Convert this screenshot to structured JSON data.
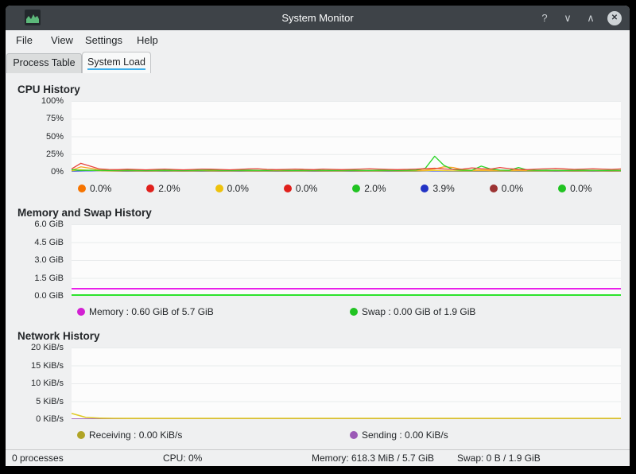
{
  "titlebar": {
    "title": "System Monitor",
    "help_glyph": "?",
    "minimize_glyph": "∨",
    "maximize_glyph": "∧",
    "close_glyph": "✕"
  },
  "menubar": {
    "items": [
      "File",
      "View",
      "Settings",
      "Help"
    ]
  },
  "tabs": {
    "process_table": "Process Table",
    "system_load": "System Load"
  },
  "accent_color": "#3daee9",
  "chart_data": [
    {
      "id": "cpu",
      "type": "line",
      "title": "CPU History",
      "ylabel_ticks": [
        "100%",
        "75%",
        "50%",
        "25%",
        "0%"
      ],
      "ylim": [
        0,
        100
      ],
      "grid": true,
      "legend_position": "bottom",
      "series": [
        {
          "name": "cpu-blue",
          "color": "#3a52d4",
          "width": 1.2,
          "values": [
            0.8,
            1.4,
            0.9,
            0.6,
            0.6,
            0.7,
            0.6,
            0.6,
            0.7,
            0.6,
            0.6,
            0.7,
            0.6,
            0.6,
            0.7,
            0.6,
            0.6,
            0.7,
            0.6,
            1.2,
            0.8,
            0.6,
            0.7,
            0.6,
            0.6,
            0.7,
            0.6,
            0.6,
            0.7,
            0.6
          ]
        },
        {
          "name": "cpu-yellow",
          "color": "#ecd12b",
          "width": 1.3,
          "values": [
            1.5,
            3,
            2,
            1.4,
            1.2,
            1.2,
            1.3,
            1.2,
            1.1,
            1.2,
            1.3,
            1.2,
            1.1,
            1.2,
            1.3,
            1.2,
            1.1,
            1.2,
            1.3,
            1.2,
            1.1,
            1.2,
            1.3,
            1.2,
            1.1,
            1.2,
            1.3,
            1.2,
            1.1,
            1.2,
            1.3,
            1.2,
            1.1,
            1.2,
            1.3,
            1.2,
            1.1,
            1.2,
            1.4,
            2,
            1.6,
            1.3,
            1.2,
            1.2,
            1.4,
            1.2,
            1.1,
            1.2,
            1.3,
            1.2,
            1.1,
            1.2,
            1.3,
            1.2,
            1.1,
            1.2,
            1.3,
            1.2,
            1.1,
            1.2
          ]
        },
        {
          "name": "cpu-orange",
          "color": "#f7a325",
          "width": 1.3,
          "values": [
            2,
            7,
            5,
            2.5,
            1.8,
            1.6,
            1.8,
            2,
            1.6,
            1.8,
            2,
            1.8,
            1.6,
            1.8,
            2,
            1.8,
            1.6,
            1.8,
            2,
            1.8,
            1.6,
            2,
            1.8,
            1.6,
            1.8,
            2,
            1.8,
            1.6,
            1.8,
            2,
            1.8,
            1.6,
            1.8,
            2,
            1.8,
            1.6,
            1.8,
            2,
            2.4,
            4,
            7,
            6,
            3,
            2.2,
            2.6,
            2.2,
            1.8,
            2,
            2.4,
            2,
            1.8,
            2,
            2.2,
            1.8,
            1.6,
            1.8,
            2,
            1.8,
            1.6,
            1.8
          ]
        },
        {
          "name": "cpu-green",
          "color": "#2ad425",
          "width": 1.3,
          "values": [
            3,
            2,
            2.2,
            2,
            1.8,
            2,
            2.2,
            2,
            1.8,
            2,
            2.2,
            2,
            1.8,
            2,
            2.2,
            2.4,
            2,
            1.8,
            2,
            2.2,
            2,
            1.8,
            2.4,
            2,
            1.8,
            2,
            2.2,
            2,
            1.8,
            2,
            2.2,
            2,
            1.8,
            2.2,
            2,
            1.8,
            2,
            2.4,
            5,
            22,
            9,
            3,
            2.2,
            2,
            8,
            4,
            2.4,
            2,
            6,
            2.4,
            2,
            2.2,
            2,
            1.8,
            2,
            2.2,
            2,
            1.8,
            2,
            2
          ]
        },
        {
          "name": "cpu-red",
          "color": "#e8443e",
          "width": 1.3,
          "values": [
            4,
            12,
            8,
            4,
            3.2,
            3,
            3.6,
            3.2,
            2.8,
            3.4,
            3.8,
            3.2,
            2.8,
            3.2,
            3.8,
            3.6,
            3.2,
            2.8,
            3.4,
            4,
            4.2,
            3.4,
            3,
            3.4,
            3.8,
            3.4,
            3,
            3.8,
            3.4,
            3,
            3.4,
            3.8,
            4.2,
            3.8,
            3.4,
            3,
            3.4,
            3.8,
            4.4,
            5,
            4,
            3.4,
            3.8,
            5.5,
            4.5,
            3.8,
            6,
            4.5,
            3.4,
            3,
            3.8,
            4.2,
            4.8,
            4,
            3.4,
            3.8,
            4.2,
            3.8,
            3.4,
            4
          ]
        }
      ],
      "legend": [
        {
          "color": "#f67400",
          "label": "0.0%"
        },
        {
          "color": "#e0201c",
          "label": "2.0%"
        },
        {
          "color": "#eec20c",
          "label": "0.0%"
        },
        {
          "color": "#e0201c",
          "label": "0.0%"
        },
        {
          "color": "#21c322",
          "label": "2.0%"
        },
        {
          "color": "#2233c5",
          "label": "3.9%"
        },
        {
          "color": "#9c3333",
          "label": "0.0%"
        },
        {
          "color": "#21c322",
          "label": "0.0%"
        }
      ]
    },
    {
      "id": "memory",
      "type": "line",
      "title": "Memory and Swap History",
      "ylabel_ticks": [
        "6.0 GiB",
        "4.5 GiB",
        "3.0 GiB",
        "1.5 GiB",
        "0.0 GiB"
      ],
      "ylim": [
        0,
        6
      ],
      "grid": true,
      "legend_position": "bottom",
      "series": [
        {
          "name": "memory",
          "color": "#ea1fea",
          "width": 2,
          "values": [
            0.6,
            0.6
          ]
        },
        {
          "name": "swap",
          "color": "#2ce32c",
          "width": 2,
          "values": [
            0.07,
            0.07
          ]
        }
      ],
      "legend": [
        {
          "color": "#d220d2",
          "label": "Memory : 0.60 GiB of 5.7 GiB"
        },
        {
          "color": "#21c322",
          "label": "Swap : 0.00 GiB of 1.9 GiB"
        }
      ]
    },
    {
      "id": "network",
      "type": "line",
      "title": "Network History",
      "ylabel_ticks": [
        "20 KiB/s",
        "15 KiB/s",
        "10 KiB/s",
        "5 KiB/s",
        "0 KiB/s"
      ],
      "ylim": [
        0,
        20
      ],
      "grid": true,
      "legend_position": "bottom",
      "series": [
        {
          "name": "sending",
          "color": "#9b59b6",
          "width": 1.3,
          "values": [
            0.05,
            0.05
          ]
        },
        {
          "name": "receiving",
          "color": "#e0ca25",
          "width": 1.6,
          "values": [
            1.6,
            0.5,
            0.28,
            0.22,
            0.2,
            0.2,
            0.2,
            0.2,
            0.2,
            0.2,
            0.2,
            0.2,
            0.2,
            0.2,
            0.2,
            0.2,
            0.2,
            0.2,
            0.2,
            0.2,
            0.2,
            0.2,
            0.2,
            0.2,
            0.2,
            0.2,
            0.2,
            0.2,
            0.2,
            0.2,
            0.2,
            0.2,
            0.2,
            0.2,
            0.2,
            0.2,
            0.2,
            0.2,
            0.2,
            0.2
          ]
        }
      ],
      "legend": [
        {
          "color": "#b0a426",
          "label": "Receiving : 0.00 KiB/s"
        },
        {
          "color": "#9b59b6",
          "label": "Sending : 0.00 KiB/s"
        }
      ]
    }
  ],
  "statusbar": {
    "processes": "0 processes",
    "cpu": "CPU: 0%",
    "memory": "Memory: 618.3 MiB / 5.7 GiB",
    "swap": "Swap: 0 B / 1.9 GiB"
  }
}
